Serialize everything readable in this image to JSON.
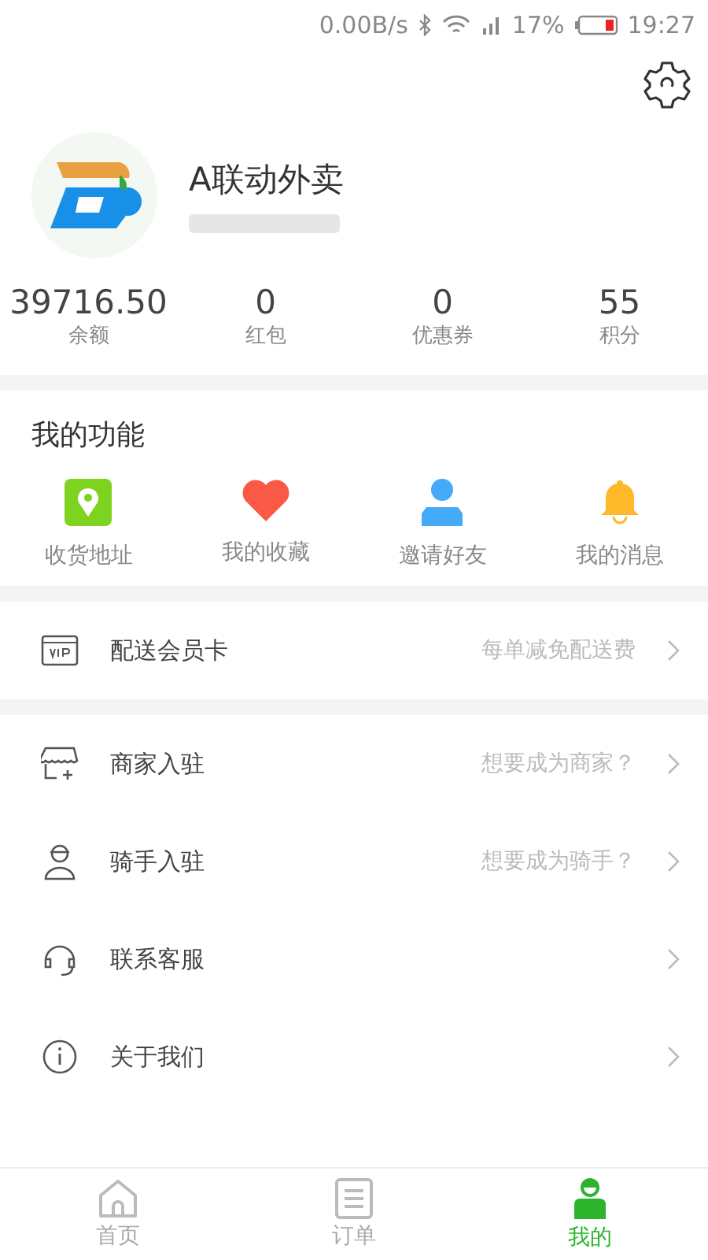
{
  "status_bar": {
    "speed": "0.00B/s",
    "battery": "17%",
    "time": "19:27"
  },
  "profile": {
    "name": "A联动外卖"
  },
  "stats": [
    {
      "value": "39716.50",
      "label": "余额"
    },
    {
      "value": "0",
      "label": "红包"
    },
    {
      "value": "0",
      "label": "优惠券"
    },
    {
      "value": "55",
      "label": "积分"
    }
  ],
  "functions": {
    "title": "我的功能",
    "items": [
      {
        "kind": "location",
        "label": "收货地址"
      },
      {
        "kind": "heart",
        "label": "我的收藏"
      },
      {
        "kind": "person",
        "label": "邀请好友"
      },
      {
        "kind": "bell",
        "label": "我的消息"
      }
    ]
  },
  "menu_groups": [
    [
      {
        "kind": "vip",
        "label": "配送会员卡",
        "hint": "每单减免配送费"
      }
    ],
    [
      {
        "kind": "shop",
        "label": "商家入驻",
        "hint": "想要成为商家？"
      },
      {
        "kind": "rider",
        "label": "骑手入驻",
        "hint": "想要成为骑手？"
      },
      {
        "kind": "headset",
        "label": "联系客服"
      },
      {
        "kind": "info",
        "label": "关于我们"
      }
    ]
  ],
  "tabs": [
    {
      "kind": "home",
      "label": "首页",
      "selected": false
    },
    {
      "kind": "orders",
      "label": "订单",
      "selected": false
    },
    {
      "kind": "me",
      "label": "我的",
      "selected": true
    }
  ]
}
